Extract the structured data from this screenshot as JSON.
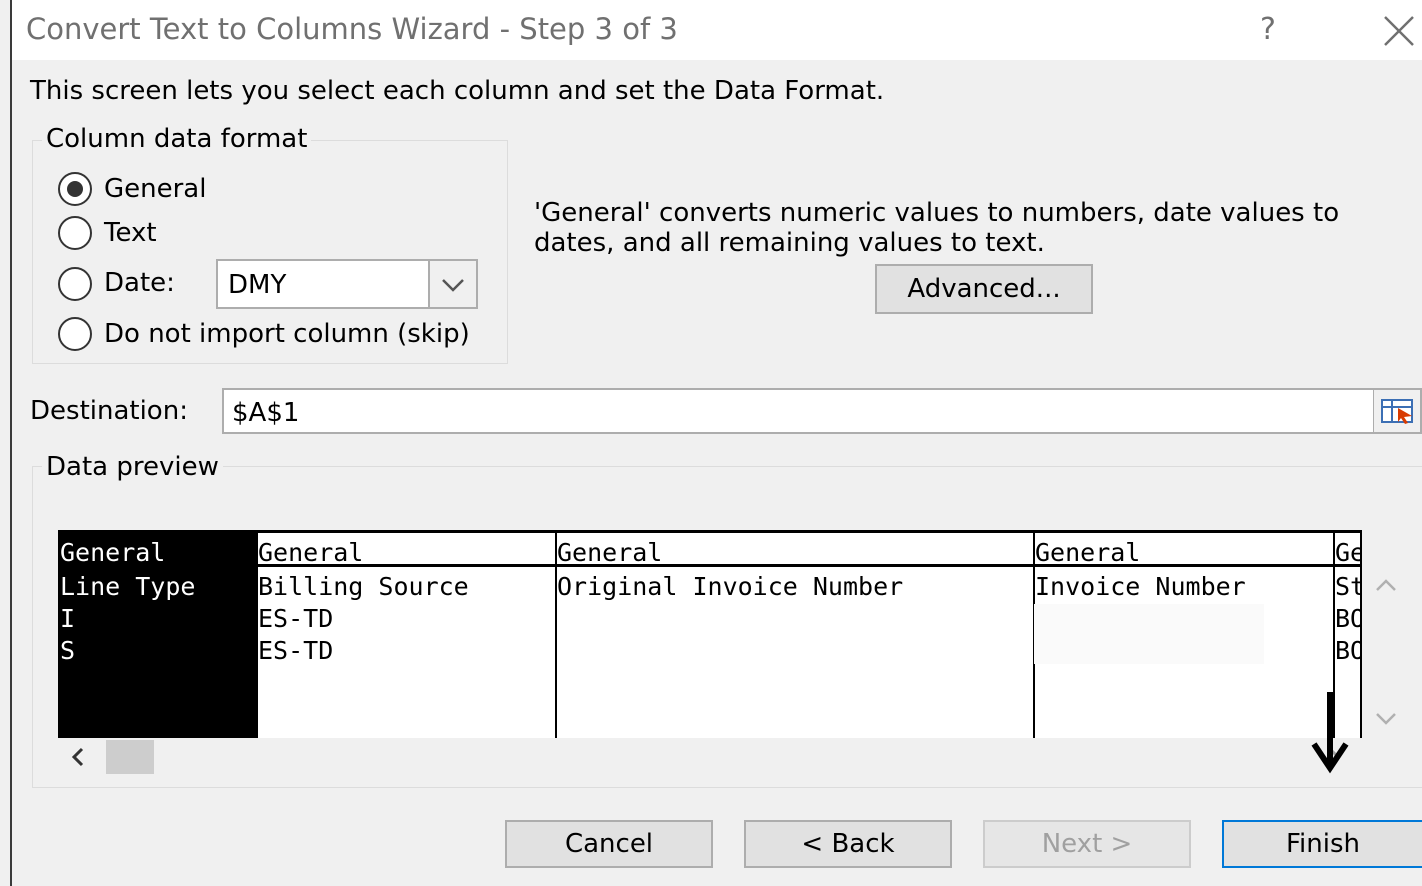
{
  "dialog": {
    "title": "Convert Text to Columns Wizard - Step 3 of 3",
    "help_label": "?",
    "intro": "This screen lets you select each column and set the Data Format."
  },
  "column_data_format": {
    "legend": "Column data format",
    "options": [
      {
        "label": "General",
        "selected": true
      },
      {
        "label": "Text",
        "selected": false
      },
      {
        "label": "Date:",
        "selected": false
      },
      {
        "label": "Do not import column (skip)",
        "selected": false
      }
    ],
    "date_format": "DMY",
    "description": "'General' converts numeric values to numbers, date values to dates, and all remaining values to text.",
    "advanced_label": "Advanced..."
  },
  "destination": {
    "label": "Destination:",
    "value": "$A$1"
  },
  "data_preview": {
    "legend": "Data preview",
    "columns": [
      {
        "format": "General",
        "header": "Line Type",
        "rows": [
          "I",
          "S"
        ],
        "selected": true
      },
      {
        "format": "General",
        "header": "Billing Source",
        "rows": [
          "ES-TD",
          "ES-TD"
        ],
        "selected": false
      },
      {
        "format": "General",
        "header": "Original Invoice Number",
        "rows": [
          "",
          ""
        ],
        "selected": false
      },
      {
        "format": "General",
        "header": "Invoice Number",
        "rows": [
          "",
          ""
        ],
        "selected": false
      },
      {
        "format": "Ge",
        "header": "St",
        "rows": [
          "BO",
          "BO"
        ],
        "selected": false
      }
    ]
  },
  "buttons": {
    "cancel": "Cancel",
    "back": "< Back",
    "next": "Next >",
    "finish": "Finish"
  },
  "colors": {
    "window_bg": "#f0f0f0",
    "finish_border": "#0078d7",
    "selected_column": "#000000"
  }
}
